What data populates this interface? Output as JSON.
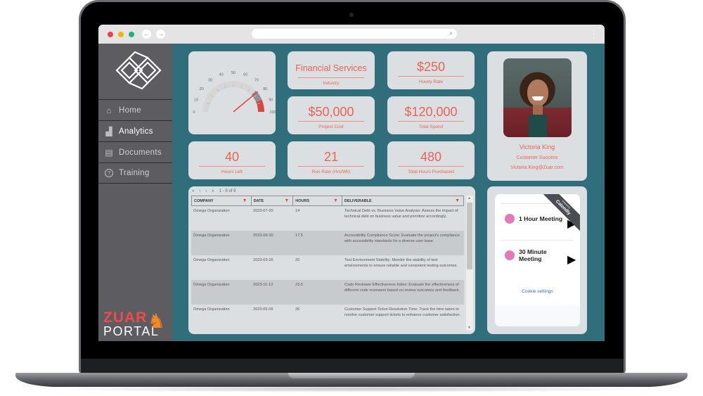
{
  "browser": {
    "back_icon": "←",
    "forward_icon": "→",
    "search_icon": "⌕",
    "menu_icon": "⋮",
    "url": ""
  },
  "sidebar": {
    "items": [
      {
        "label": "Home",
        "icon": "home-icon",
        "glyph": "⌂",
        "active": false
      },
      {
        "label": "Analytics",
        "icon": "analytics-icon",
        "glyph": "▟",
        "active": true
      },
      {
        "label": "Documents",
        "icon": "documents-icon",
        "glyph": "▤",
        "active": false
      },
      {
        "label": "Training",
        "icon": "help-circle-icon",
        "glyph": "?",
        "active": false
      }
    ],
    "brand": {
      "top": "ZUAR",
      "bottom": "PORTAL"
    }
  },
  "gauge": {
    "min": 0,
    "max": 100,
    "value": 78,
    "ticks": [
      "0",
      "10",
      "20",
      "30",
      "40",
      "50",
      "60",
      "70",
      "80",
      "90",
      "100"
    ],
    "bands": [
      {
        "from": 0,
        "to": 76,
        "color": "#d6d6d6"
      },
      {
        "from": 76,
        "to": 87,
        "color": "#8e9093"
      },
      {
        "from": 87,
        "to": 100,
        "color": "#d9453f"
      }
    ],
    "needle_color": "#e8473a"
  },
  "kpis": {
    "industry": {
      "value": "Financial Services",
      "label": "Industry"
    },
    "hourly_rate": {
      "value": "$250",
      "label": "Hourly Rate"
    },
    "project_cost": {
      "value": "$50,000",
      "label": "Project Cost"
    },
    "total_spend": {
      "value": "$120,000",
      "label": "Total Spend"
    },
    "hours_left": {
      "value": "40",
      "label": "Hours Left"
    },
    "run_rate": {
      "value": "21",
      "label": "Run Rate (Hrs/Wk)"
    },
    "total_hours": {
      "value": "480",
      "label": "Total Hours Purchased"
    }
  },
  "profile": {
    "name": "Victoria King",
    "role": "Customer Success",
    "email": "Victoria.King@Zuar.com"
  },
  "table": {
    "pager": {
      "first": "«",
      "prev": "‹",
      "next": "›",
      "last": "»",
      "range": "1 - 9 of 9"
    },
    "columns": [
      "COMPANY",
      "DATE",
      "HOURS",
      "DELIVERABLE"
    ],
    "rows": [
      {
        "company": "Omega Organization",
        "date": "2023-07-20",
        "hours": "14",
        "deliverable": "Technical Debt vs. Business Value Analysis: Assess the impact of technical debt on business value and prioritize accordingly."
      },
      {
        "company": "Omega Organization",
        "date": "2023-09-30",
        "hours": "17.5",
        "deliverable": "Accessibility Compliance Score: Evaluate the project's compliance with accessibility standards for a diverse user base."
      },
      {
        "company": "Omega Organization",
        "date": "2023-03-26",
        "hours": "20",
        "deliverable": "Test Environment Stability: Monitor the stability of test environments to ensure reliable and consistent testing outcomes."
      },
      {
        "company": "Omega Organization",
        "date": "2023-11-13",
        "hours": "23.5",
        "deliverable": "Code Reviewer Effectiveness Index: Evaluate the effectiveness of different code reviewers based on review outcomes and feedback."
      },
      {
        "company": "Omega Organization",
        "date": "2023-05-05",
        "hours": "26",
        "deliverable": "Customer Support Ticket Resolution Time: Track the time taken to resolve customer support tickets to enhance customer satisfaction."
      }
    ]
  },
  "calendly": {
    "ribbon_small": "powered by",
    "ribbon_brand": "Calendly",
    "events": [
      {
        "title": "1 Hour Meeting",
        "color": "#e37ab8"
      },
      {
        "title": "30 Minute Meeting",
        "color": "#e37ab8"
      }
    ],
    "cookie_label": "Cookie settings"
  }
}
